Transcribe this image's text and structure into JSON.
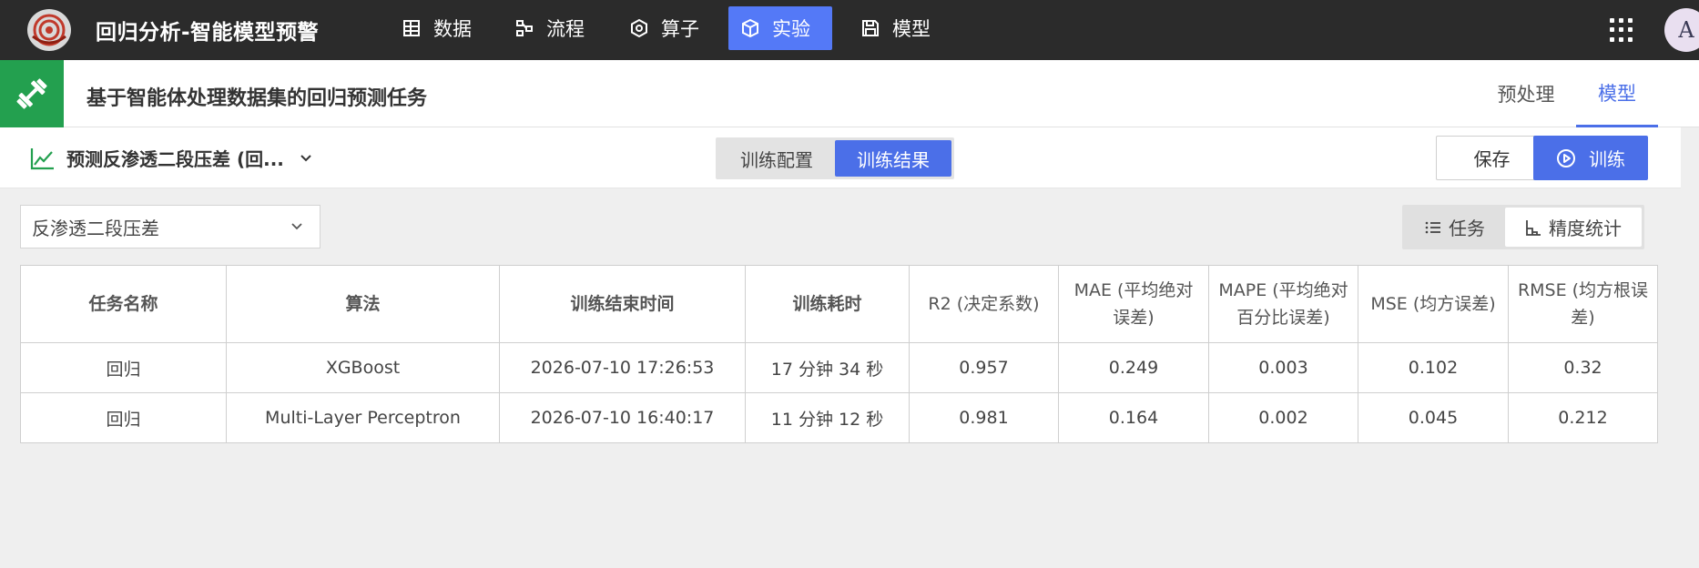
{
  "app": {
    "title": "回归分析-智能模型预警"
  },
  "nav": {
    "items": [
      {
        "label": "数据",
        "icon": "table-icon"
      },
      {
        "label": "流程",
        "icon": "flow-icon"
      },
      {
        "label": "算子",
        "icon": "hexagon-icon"
      },
      {
        "label": "实验",
        "icon": "cube-icon",
        "active": true
      },
      {
        "label": "模型",
        "icon": "save-icon"
      }
    ]
  },
  "user": {
    "avatar_initial": "A"
  },
  "header": {
    "task_title": "基于智能体处理数据集的回归预测任务",
    "tabs": [
      {
        "label": "预处理",
        "active": false
      },
      {
        "label": "模型",
        "active": true
      }
    ]
  },
  "toolbar": {
    "target_label": "预测反渗透二段压差 (回...",
    "segments": [
      {
        "label": "训练配置",
        "active": false
      },
      {
        "label": "训练结果",
        "active": true
      }
    ],
    "save_label": "保存",
    "train_label": "训练"
  },
  "filter": {
    "selected": "反渗透二段压差"
  },
  "view_toggle": [
    {
      "label": "任务",
      "active": false
    },
    {
      "label": "精度统计",
      "active": true
    }
  ],
  "table": {
    "headers": [
      "任务名称",
      "算法",
      "训练结束时间",
      "训练耗时",
      "R2 (决定系数)",
      "MAE (平均绝对误差)",
      "MAPE (平均绝对百分比误差)",
      "MSE (均方误差)",
      "RMSE (均方根误差)"
    ],
    "rows": [
      [
        "回归",
        "XGBoost",
        "2026-07-10 17:26:53",
        "17 分钟 34 秒",
        "0.957",
        "0.249",
        "0.003",
        "0.102",
        "0.32"
      ],
      [
        "回归",
        "Multi-Layer Perceptron",
        "2026-07-10 16:40:17",
        "11 分钟 12 秒",
        "0.981",
        "0.164",
        "0.002",
        "0.045",
        "0.212"
      ]
    ]
  },
  "colors": {
    "accent": "#4b6fe8",
    "brand_green": "#23a04f",
    "topbar": "#2b2b2b"
  }
}
